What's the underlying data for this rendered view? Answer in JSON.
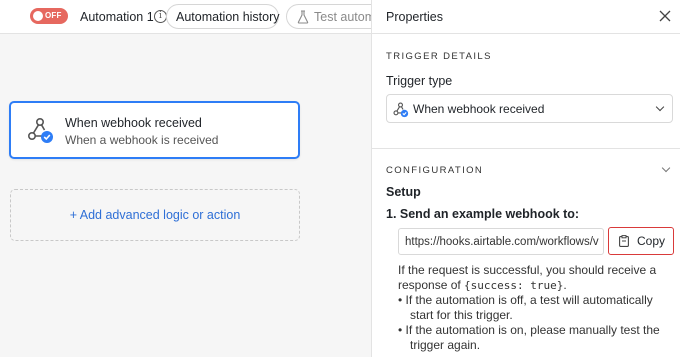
{
  "header": {
    "toggle_label": "OFF",
    "automation_name": "Automation 1",
    "history_button": "Automation history",
    "test_button": "Test automation"
  },
  "canvas": {
    "trigger": {
      "title": "When webhook received",
      "subtitle": "When a webhook is received"
    },
    "add_action": "+ Add advanced logic or action"
  },
  "panel": {
    "title": "Properties",
    "trigger_details": {
      "heading": "TRIGGER DETAILS",
      "trigger_type_label": "Trigger type",
      "trigger_type_value": "When webhook received"
    },
    "configuration": {
      "heading": "CONFIGURATION",
      "setup_label": "Setup",
      "step1": "1. Send an example webhook to:",
      "webhook_url": "https://hooks.airtable.com/workflows/v",
      "copy_button": "Copy",
      "help_line1": "If the request is successful, you should receive a",
      "help_line2_prefix": "response of ",
      "help_line2_code": "{success: true}",
      "help_line2_suffix": ".",
      "bullet1_line1": "•  If the automation is off, a test will automatically",
      "bullet1_line2": "start for this trigger.",
      "bullet2_line1": "•  If the automation is on, please manually test the",
      "bullet2_line2": "trigger again."
    }
  },
  "colors": {
    "accent": "#2e7df6",
    "toggle_off": "#e6685f",
    "highlight": "#d93a3a",
    "link": "#2e6fd6"
  }
}
